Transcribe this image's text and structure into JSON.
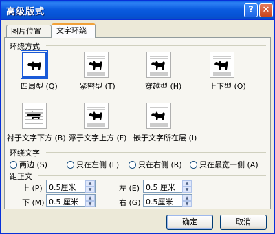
{
  "window": {
    "title": "高级版式"
  },
  "titlebar": {
    "help_glyph": "?",
    "close_glyph": "✕"
  },
  "tabs": [
    {
      "label": "图片位置"
    },
    {
      "label": "文字环绕"
    }
  ],
  "wrap_style": {
    "group_label": "环绕方式",
    "options": [
      {
        "label": "四周型 (Q)",
        "icon": "wrap-square-icon",
        "selected": true
      },
      {
        "label": "紧密型 (T)",
        "icon": "wrap-tight-icon"
      },
      {
        "label": "穿越型 (H)",
        "icon": "wrap-through-icon"
      },
      {
        "label": "上下型 (O)",
        "icon": "wrap-top-bottom-icon"
      },
      {
        "label": "衬于文字下方 (B)",
        "icon": "behind-text-icon"
      },
      {
        "label": "浮于文字上方 (F)",
        "icon": "in-front-of-text-icon"
      },
      {
        "label": "嵌于文字所在层 (I)",
        "icon": "inline-with-text-icon"
      }
    ]
  },
  "wrap_text": {
    "group_label": "环绕文字",
    "options": [
      {
        "label": "两边 (S)"
      },
      {
        "label": "只在左侧 (L)"
      },
      {
        "label": "只在右侧 (R)"
      },
      {
        "label": "只在最宽一侧 (A)"
      }
    ]
  },
  "distance": {
    "group_label": "距正文",
    "top": {
      "label": "上 (P)",
      "value": "0.5厘米"
    },
    "bottom": {
      "label": "下 (M)",
      "value": "0.5 厘米"
    },
    "left": {
      "label": "左 (E)",
      "value": "0.5 厘米"
    },
    "right": {
      "label": "右 (G)",
      "value": "0.5厘米"
    }
  },
  "buttons": {
    "ok": "确定",
    "cancel": "取消"
  },
  "colors": {
    "title_blue": "#0a5fe0",
    "close_red": "#c9451e",
    "selection_blue": "#1a5ad8"
  }
}
